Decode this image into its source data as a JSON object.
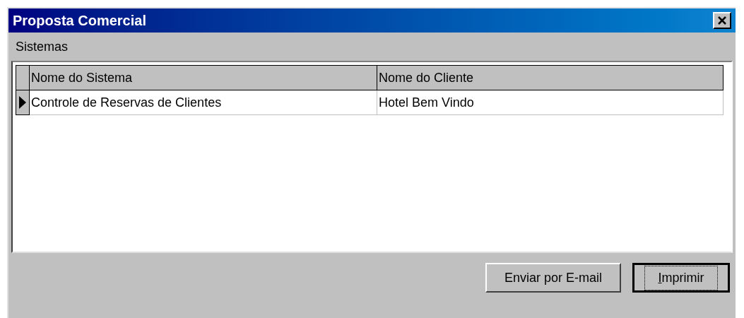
{
  "window": {
    "title": "Proposta Comercial"
  },
  "section_label": "Sistemas",
  "table": {
    "columns": [
      "Nome do Sistema",
      "Nome do Cliente"
    ],
    "rows": [
      {
        "selected": true,
        "cells": [
          "Controle de Reservas de Clientes",
          "Hotel Bem Vindo"
        ]
      }
    ]
  },
  "buttons": [
    {
      "label": "Enviar por E-mail",
      "default": false
    },
    {
      "label": "Imprimir",
      "default": true
    }
  ]
}
